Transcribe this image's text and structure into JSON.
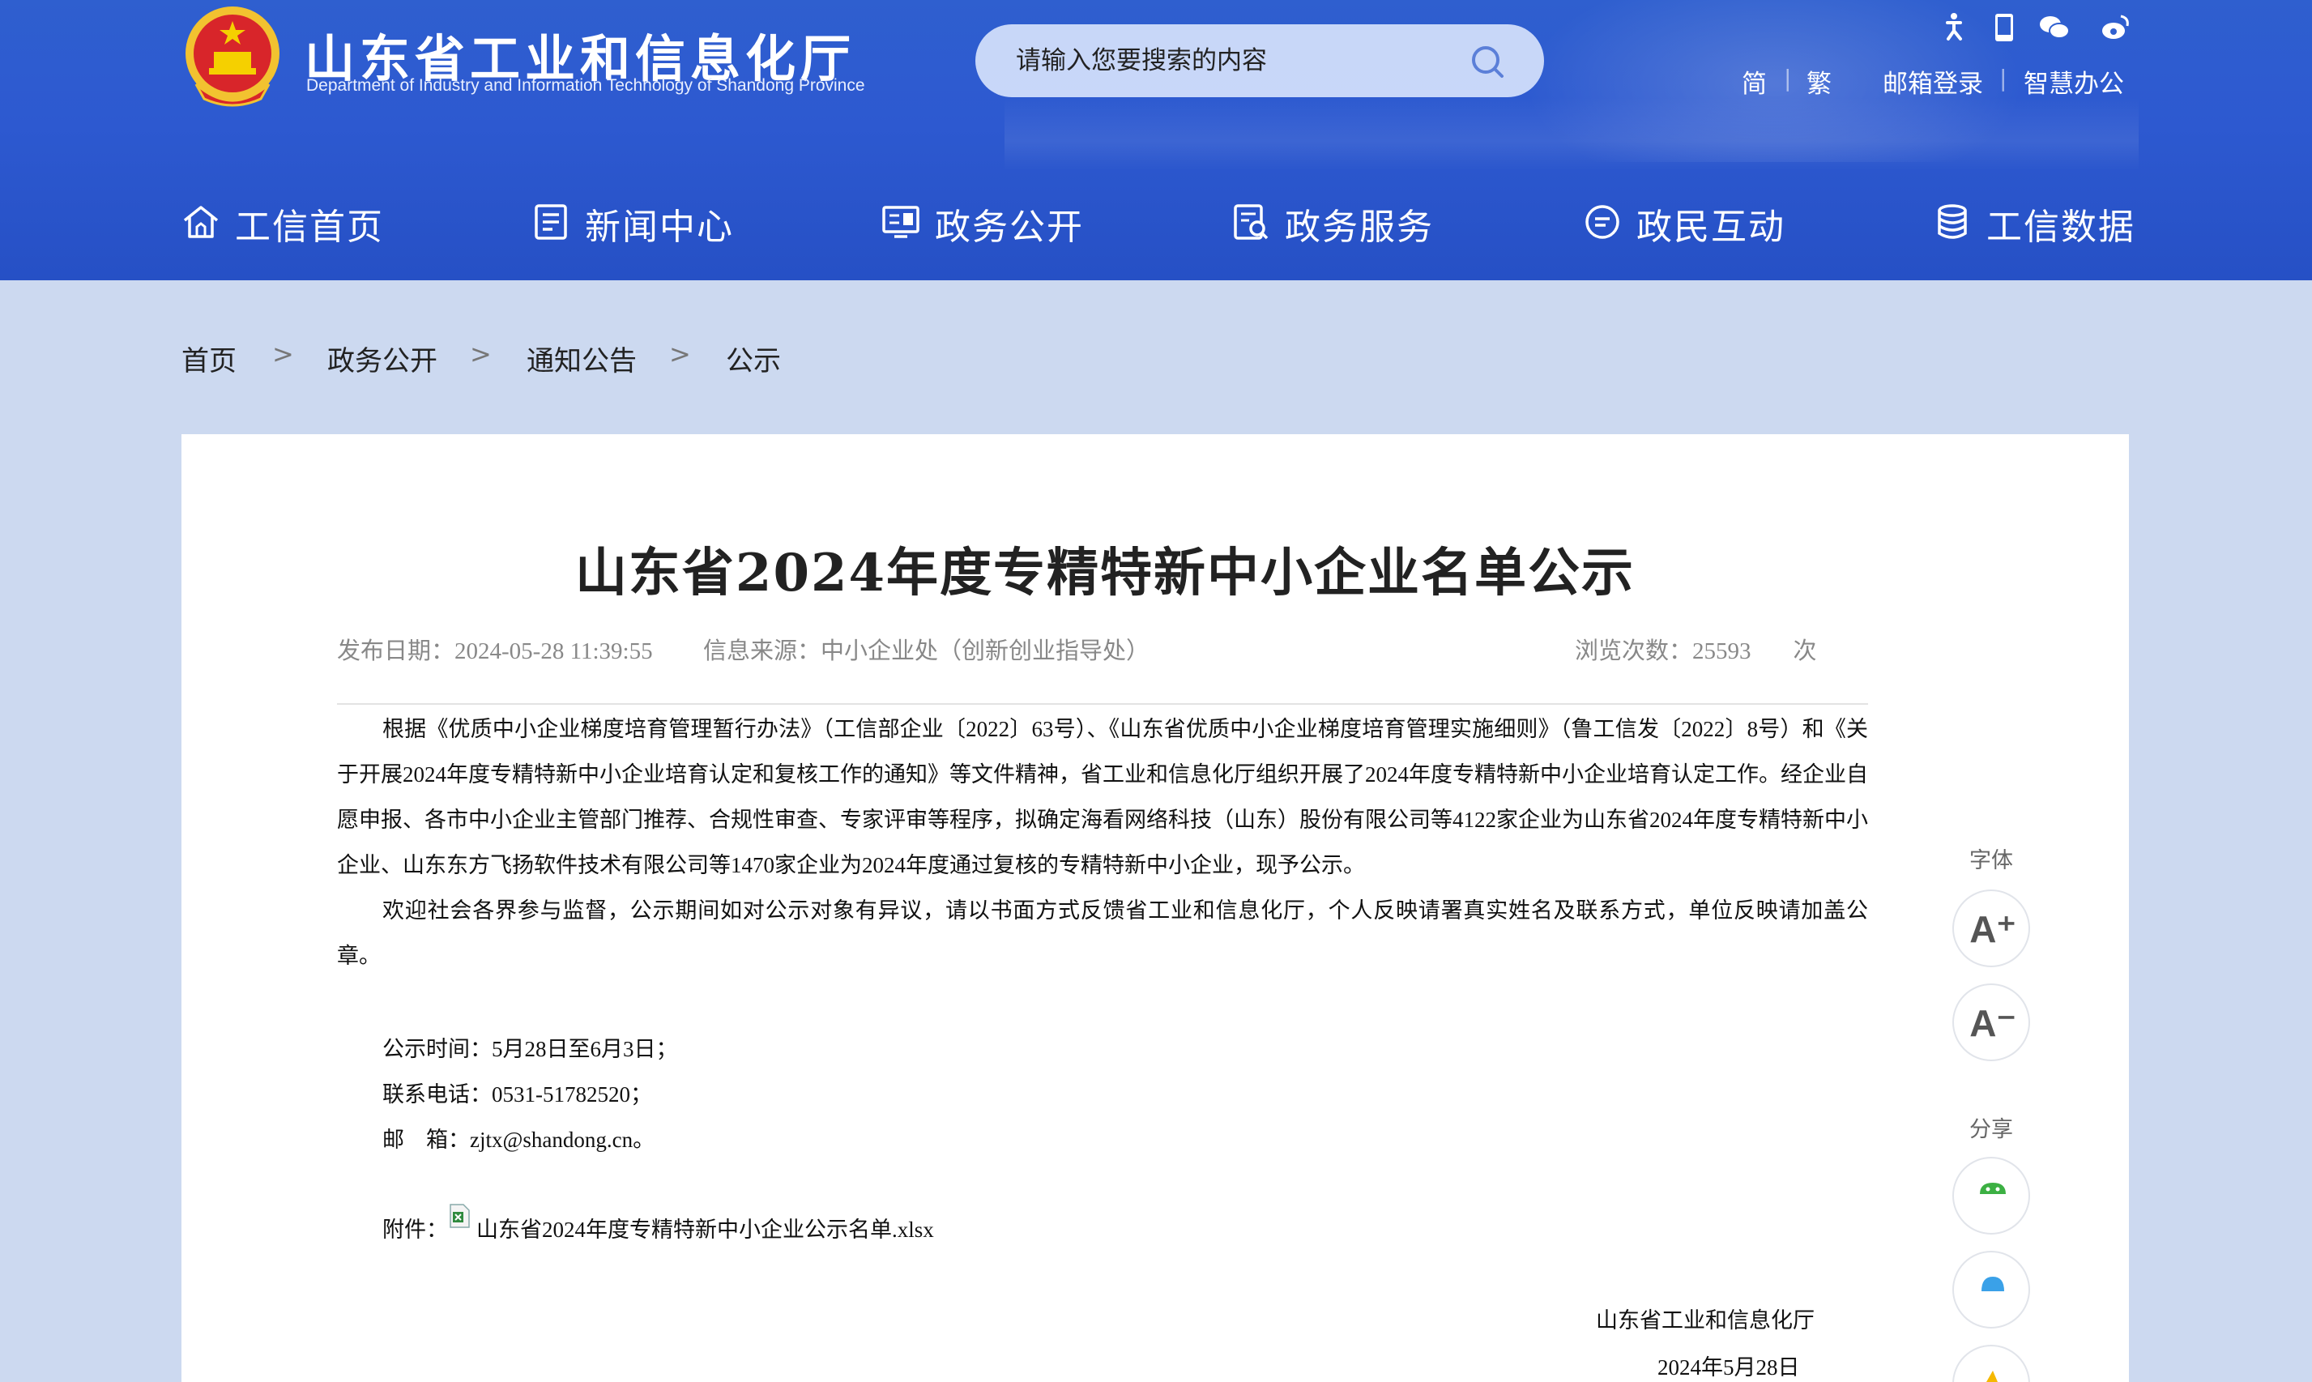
{
  "header": {
    "site_title": "山东省工业和信息化厅",
    "site_subtitle": "Department of Industry and Information Technology of Shandong Province",
    "search_placeholder": "请输入您要搜索的内容",
    "top_icons": [
      "accessibility-icon",
      "mobile-icon",
      "wechat-icon",
      "weibo-icon"
    ],
    "top_links": {
      "simplified": "简",
      "traditional": "繁",
      "mail_login": "邮箱登录",
      "smart_office": "智慧办公"
    },
    "nav": [
      {
        "label": "工信首页",
        "icon": "home-icon"
      },
      {
        "label": "新闻中心",
        "icon": "news-icon"
      },
      {
        "label": "政务公开",
        "icon": "screen-icon"
      },
      {
        "label": "政务服务",
        "icon": "service-icon"
      },
      {
        "label": "政民互动",
        "icon": "chat-icon"
      },
      {
        "label": "工信数据",
        "icon": "database-icon"
      }
    ]
  },
  "breadcrumb": {
    "items": [
      "首页",
      "政务公开",
      "通知公告",
      "公示"
    ],
    "separator": ">"
  },
  "article": {
    "title": "山东省2024年度专精特新中小企业名单公示",
    "date_label": "发布日期：",
    "date": "2024-05-28 11:39:55",
    "source_label": "信息来源：",
    "source": "中小企业处（创新创业指导处）",
    "views_label": "浏览次数：",
    "views": "25593",
    "views_unit": "次",
    "para1": "根据《优质中小企业梯度培育管理暂行办法》（工信部企业〔2022〕63号）、《山东省优质中小企业梯度培育管理实施细则》（鲁工信发〔2022〕8号）和《关于开展2024年度专精特新中小企业培育认定和复核工作的通知》等文件精神，省工业和信息化厅组织开展了2024年度专精特新中小企业培育认定工作。经企业自愿申报、各市中小企业主管部门推荐、合规性审查、专家评审等程序，拟确定海看网络科技（山东）股份有限公司等4122家企业为山东省2024年度专精特新中小企业、山东东方飞扬软件技术有限公司等1470家企业为2024年度通过复核的专精特新中小企业，现予公示。",
    "para2": "欢迎社会各界参与监督，公示期间如对公示对象有异议，请以书面方式反馈省工业和信息化厅，个人反映请署真实姓名及联系方式，单位反映请加盖公章。",
    "period": "公示时间：5月28日至6月3日；",
    "phone": "联系电话：0531-51782520；",
    "email": "邮　箱：zjtx@shandong.cn。",
    "attachment_label": "附件：",
    "attachment_name": "山东省2024年度专精特新中小企业公示名单.xlsx",
    "signature_org": "山东省工业和信息化厅",
    "signature_date": "2024年5月28日"
  },
  "side_tools": {
    "font_label": "字体",
    "font_increase": "A⁺",
    "font_decrease": "A⁻",
    "share_label": "分享",
    "share_icons": [
      "wechat-share-icon",
      "qq-share-icon",
      "qzone-share-icon"
    ]
  },
  "colors": {
    "header_blue": "#2d59d0",
    "page_bg": "#ccd9f0",
    "panel_bg": "#ffffff"
  }
}
